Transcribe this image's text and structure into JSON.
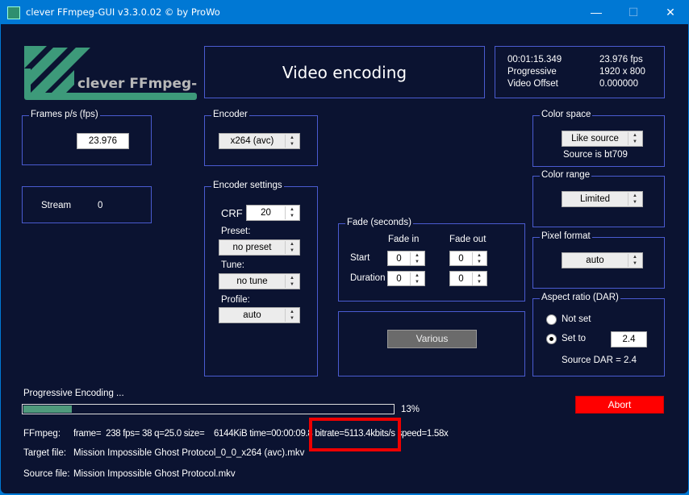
{
  "window": {
    "title": "clever FFmpeg-GUI v3.3.0.02   © by ProWo",
    "minimize": "—",
    "maximize": "☐",
    "close": "✕"
  },
  "logo": {
    "text": "clever FFmpeg-GUI"
  },
  "header": {
    "title": "Video encoding"
  },
  "info": {
    "duration": "00:01:15.349",
    "fps": "23.976 fps",
    "scan": "Progressive",
    "resolution": "1920 x 800",
    "offset_label": "Video Offset",
    "offset": "0.000000"
  },
  "frames": {
    "legend": "Frames p/s (fps)",
    "value": "23.976"
  },
  "stream": {
    "label": "Stream",
    "value": "0"
  },
  "encoder": {
    "legend": "Encoder",
    "value": "x264 (avc)"
  },
  "encoder_settings": {
    "legend": "Encoder settings",
    "crf_label": "CRF",
    "crf": "20",
    "preset_label": "Preset:",
    "preset": "no preset",
    "tune_label": "Tune:",
    "tune": "no tune",
    "profile_label": "Profile:",
    "profile": "auto"
  },
  "fade": {
    "legend": "Fade (seconds)",
    "fade_in": "Fade in",
    "fade_out": "Fade out",
    "start": "Start",
    "duration": "Duration",
    "start_in": "0",
    "start_out": "0",
    "dur_in": "0",
    "dur_out": "0"
  },
  "various": {
    "label": "Various"
  },
  "color_space": {
    "legend": "Color space",
    "value": "Like source",
    "note": "Source is bt709"
  },
  "color_range": {
    "legend": "Color range",
    "value": "Limited"
  },
  "pixel_format": {
    "legend": "Pixel format",
    "value": "auto"
  },
  "aspect": {
    "legend": "Aspect ratio (DAR)",
    "not_set": "Not set",
    "set_to": "Set to",
    "value": "2.4",
    "source": "Source DAR = 2.4",
    "selected": "set_to"
  },
  "progress": {
    "status": "Progressive Encoding ...",
    "percent": 13,
    "percent_label": "13%"
  },
  "abort": {
    "label": "Abort"
  },
  "ffmpeg": {
    "label": "FFmpeg:",
    "line": "frame=  238 fps= 38 q=25.0 size=    6144KiB time=00:00:09.8 bitrate=5113.4kbits/s speed=1.58x"
  },
  "target": {
    "label": "Target file:",
    "value": "Mission Impossible Ghost Protocol_0_0_x264 (avc).mkv"
  },
  "source": {
    "label": "Source file:",
    "value": "Mission Impossible Ghost Protocol.mkv"
  },
  "colors": {
    "accent": "#0078d4",
    "background": "#0b1331",
    "abort": "#ff0000",
    "progress": "#4f9a7c"
  }
}
